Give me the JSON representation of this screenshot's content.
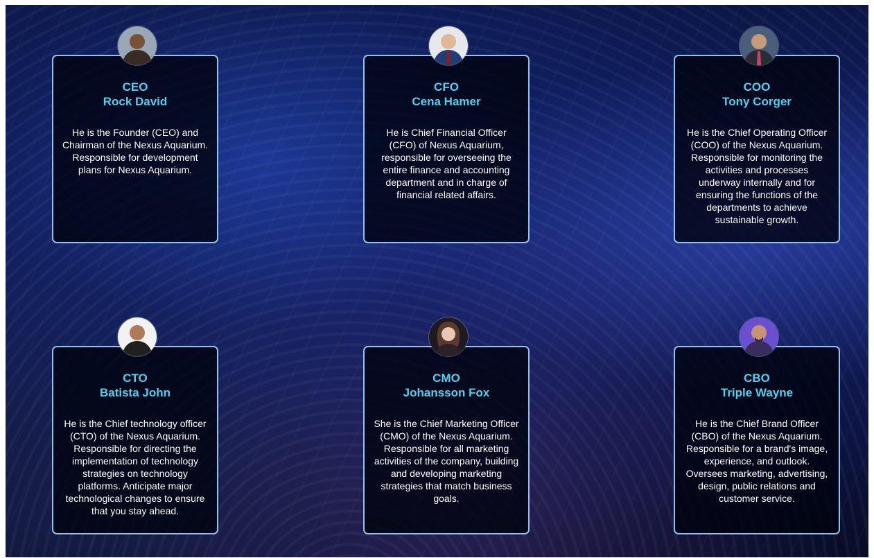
{
  "team": [
    {
      "role": "CEO",
      "name": "Rock David",
      "bio": "He is the Founder (CEO) and Chairman of the Nexus Aquarium. Responsible for development plans for Nexus Aquarium.",
      "avatar_icon": "person-portrait-icon",
      "avatar_color": "#3a2a24"
    },
    {
      "role": "CFO",
      "name": "Cena Hamer",
      "bio": "He is Chief Financial Officer (CFO) of Nexus Aquarium, responsible for overseeing the entire finance and accounting department and in charge of financial related affairs.",
      "avatar_icon": "person-portrait-icon",
      "avatar_color": "#1f3e73"
    },
    {
      "role": "COO",
      "name": "Tony Corger",
      "bio": "He is the Chief Operating Officer (COO) of the Nexus Aquarium. Responsible for monitoring the activities and processes underway internally and for ensuring the functions of the departments to achieve sustainable growth.",
      "avatar_icon": "person-portrait-icon",
      "avatar_color": "#2b2b33"
    },
    {
      "role": "CTO",
      "name": "Batista John",
      "bio": "He is the Chief technology officer (CTO) of the Nexus Aquarium. Responsible for directing the implementation of technology strategies on technology platforms. Anticipate major technological changes to ensure that you stay ahead.",
      "avatar_icon": "person-portrait-icon",
      "avatar_color": "#202020"
    },
    {
      "role": "CMO",
      "name": "Johansson Fox",
      "bio": "She is the Chief Marketing Officer (CMO) of the Nexus Aquarium. Responsible for all marketing activities of the company, building and developing marketing strategies that match business goals.",
      "avatar_icon": "person-portrait-icon",
      "avatar_color": "#5a3a2e"
    },
    {
      "role": "CBO",
      "name": "Triple Wayne",
      "bio": "He is the Chief Brand Officer (CBO) of the Nexus Aquarium. Responsible for a brand's image, experience, and outlook. Oversees marketing, advertising, design, public relations and customer service.",
      "avatar_icon": "person-portrait-icon",
      "avatar_color": "#3b2c5e"
    }
  ],
  "colors": {
    "heading": "#4fd0f0",
    "card_border": "#8fc3ef",
    "card_background": "rgba(0,3,14,0.8)",
    "text": "#ffffff"
  }
}
